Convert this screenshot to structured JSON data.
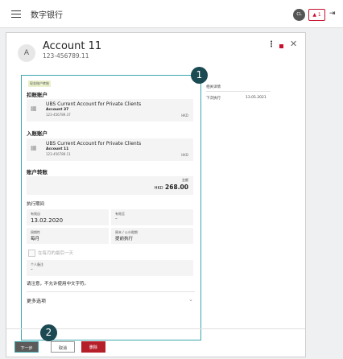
{
  "topbar": {
    "brand": "数字银行",
    "user_initials": "CL",
    "notifications": "1"
  },
  "account": {
    "avatar": "A",
    "name": "Account 11",
    "number": "123-456789.11"
  },
  "form": {
    "tag": "现金账户转账",
    "debit_heading": "扣账账户",
    "debit": {
      "title": "UBS Current Account for Private Clients",
      "name": "Account 37",
      "number": "123-456789.37",
      "currency": "HKD"
    },
    "credit_heading": "入账账户",
    "credit": {
      "title": "UBS Current Account for Private Clients",
      "name": "Account 11",
      "number": "123-456789.11",
      "currency": "HKD"
    },
    "transfer_heading": "账户转账",
    "amount_label": "金额",
    "amount_currency": "HKD",
    "amount_value": "268.00",
    "execution_heading": "执行期间",
    "valid_from_label": "有效自",
    "valid_from_value": "13.02.2020",
    "valid_until_label": "有效至",
    "valid_until_value": "–",
    "frequency_label": "周期性",
    "frequency_value": "每月",
    "weekend_label": "周末 / 公众假期",
    "weekend_value": "提前执行",
    "month_end_label": "在每月的最后一天",
    "remark_label": "个人备注",
    "remark_value": "–",
    "notice": "请注意，不允许使用中文字符。",
    "more_options": "更多选项"
  },
  "side": {
    "heading": "相关详情",
    "row_label": "下次执行",
    "row_value": "13.05.2021"
  },
  "callouts": {
    "one": "1",
    "two": "2"
  },
  "buttons": {
    "next": "下一步",
    "cancel": "取消",
    "delete": "删除"
  },
  "colors": {
    "accent": "#3aa6ad",
    "danger": "#b51f2a",
    "callout": "#1b4a52"
  }
}
